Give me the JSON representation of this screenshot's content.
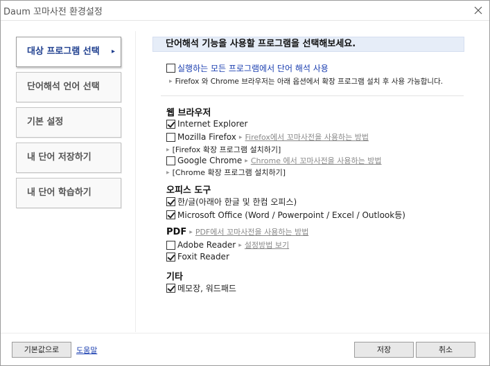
{
  "window": {
    "title": "Daum 꼬마사전 환경설정"
  },
  "sidebar": {
    "items": [
      {
        "label": "대상 프로그램 선택",
        "active": true
      },
      {
        "label": "단어해석 언어 선택"
      },
      {
        "label": "기본 설정"
      },
      {
        "label": "내 단어 저장하기"
      },
      {
        "label": "내 단어 학습하기"
      }
    ]
  },
  "main": {
    "header": "단어해석 기능을 사용할 프로그램을 선택해보세요.",
    "all_programs": {
      "label": "실행하는 모든 프로그램에서 단어 해석 사용",
      "checked": false
    },
    "all_note": "Firefox 와 Chrome 브라우저는 아래 옵션에서 확장 프로그램 설치 후 사용 가능합니다.",
    "browser": {
      "title": "웹 브라우저",
      "ie": {
        "label": "Internet Explorer",
        "checked": true
      },
      "firefox": {
        "label": "Mozilla Firefox",
        "checked": false,
        "link": "Firefox에서 꼬마사전을 사용하는 방법",
        "install": "[Firefox 확장 프로그램 설치하기]"
      },
      "chrome": {
        "label": "Google Chrome",
        "checked": false,
        "link": "Chrome 에서 꼬마사전을 사용하는 방법",
        "install": "[Chrome 확장 프로그램 설치하기]"
      }
    },
    "office": {
      "title": "오피스 도구",
      "hangul": {
        "label": "한/글(아래아 한글 및 한컴 오피스)",
        "checked": true
      },
      "msoffice": {
        "label": "Microsoft Office (Word / Powerpoint / Excel / Outlook등)",
        "checked": true
      }
    },
    "pdf": {
      "title": "PDF",
      "title_link": "PDF에서 꼬마사전을 사용하는 방법",
      "adobe": {
        "label": "Adobe Reader",
        "checked": false,
        "link": "설정방법 보기"
      },
      "foxit": {
        "label": "Foxit Reader",
        "checked": true
      }
    },
    "etc": {
      "title": "기타",
      "notepad": {
        "label": "메모장, 워드패드",
        "checked": true
      }
    }
  },
  "footer": {
    "defaults_label": "기본값으로",
    "help_label": "도움말",
    "save_label": "저장",
    "cancel_label": "취소"
  }
}
